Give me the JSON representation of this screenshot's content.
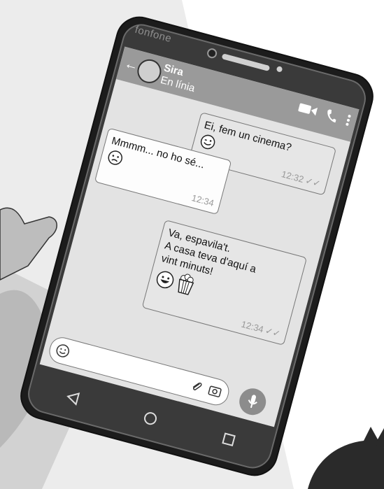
{
  "phone": {
    "brand": "fonfone"
  },
  "chat": {
    "contact_name": "Sira",
    "contact_status": "En línia",
    "messages": [
      {
        "direction": "out",
        "text": "Ei, fem un cinema?",
        "time": "12:32",
        "emoji": "wink-face"
      },
      {
        "direction": "in",
        "text": "Mmmm... no ho sé...",
        "time": "12:34",
        "emoji": "worried-face"
      },
      {
        "direction": "out",
        "line1": "Va, espavila't.",
        "line2": "A casa teva d'aquí a",
        "line3": "vint minuts!",
        "time": "12:34",
        "emoji": [
          "grinning-face",
          "popcorn"
        ]
      }
    ]
  },
  "icons": [
    "back-arrow-icon",
    "video-icon",
    "call-icon",
    "more-vert-icon",
    "smile-icon",
    "paperclip-icon",
    "camera-icon",
    "mic-icon",
    "back-nav-icon",
    "home-nav-icon",
    "recents-nav-icon"
  ]
}
